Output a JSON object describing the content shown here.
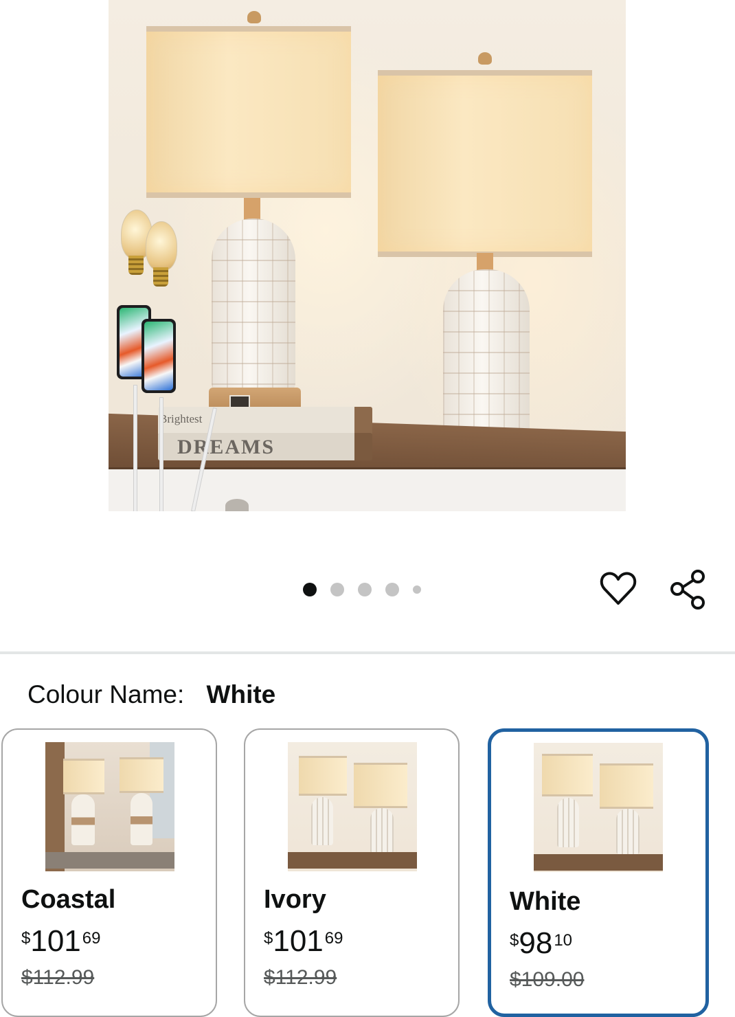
{
  "carousel": {
    "total_images": 5,
    "active_index": 0
  },
  "hero_image": {
    "book_title_small": "Brightest",
    "book_title_large": "DREAMS"
  },
  "actions": {
    "wishlist_icon": "heart-icon",
    "share_icon": "share-icon"
  },
  "colour": {
    "label": "Colour Name:",
    "selected_value": "White"
  },
  "swatches": [
    {
      "name": "Coastal",
      "currency": "$",
      "whole": "101",
      "fraction": "69",
      "list_price": "$112.99",
      "selected": false
    },
    {
      "name": "Ivory",
      "currency": "$",
      "whole": "101",
      "fraction": "69",
      "list_price": "$112.99",
      "selected": false
    },
    {
      "name": "White",
      "currency": "$",
      "whole": "98",
      "fraction": "10",
      "list_price": "$109.00",
      "selected": true
    }
  ],
  "colors": {
    "selected_border": "#2162a1",
    "unselected_border": "#a6a6a6",
    "divider": "#e3e6e6",
    "text": "#0f1111",
    "muted_text": "#565959"
  }
}
